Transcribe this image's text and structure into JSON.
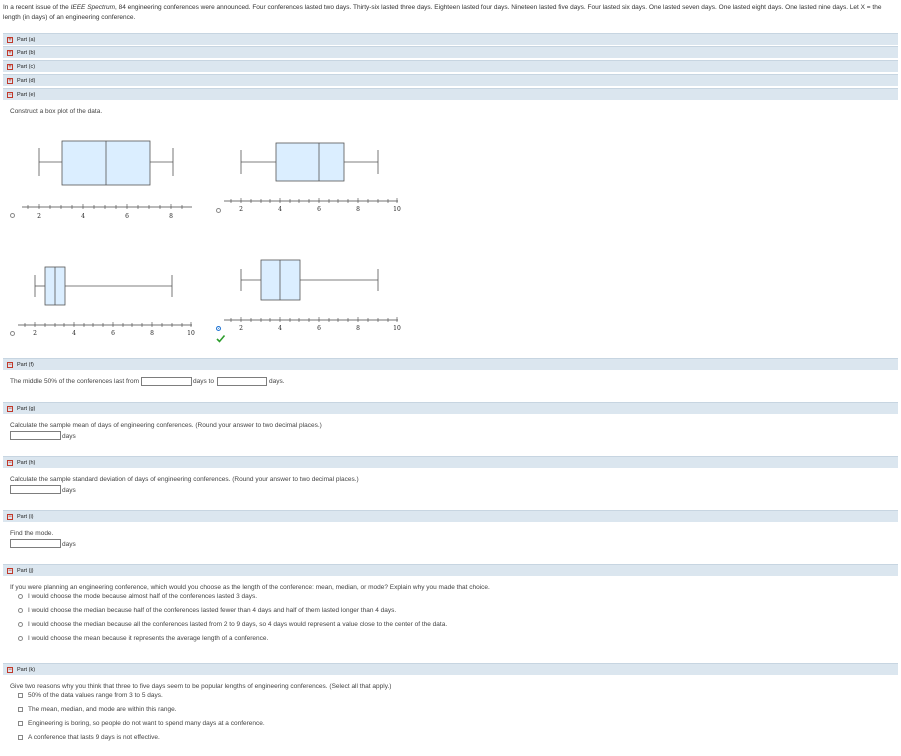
{
  "intro": {
    "text_before": "In a recent issue of the ",
    "journal": "IEEE Spectrum",
    "text_after": ", 84 engineering conferences were announced. Four conferences lasted two days. Thirty-six lasted three days. Eighteen lasted four days. Nineteen lasted five days. Four lasted six days. One lasted seven days. One lasted eight days. One lasted nine days. Let X = the length (in days) of an engineering conference."
  },
  "parts": {
    "a": "Part (a)",
    "b": "Part (b)",
    "c": "Part (c)",
    "d": "Part (d)",
    "e": "Part (e)",
    "f": "Part (f)",
    "g": "Part (g)",
    "h": "Part (h)",
    "i": "Part (i)",
    "j": "Part (j)",
    "k": "Part (k)"
  },
  "part_e": {
    "prompt": "Construct a box plot of the data.",
    "plots": [
      {
        "ticks": [
          "2",
          "4",
          "6",
          "8"
        ],
        "selected": false
      },
      {
        "ticks": [
          "2",
          "4",
          "6",
          "8",
          "10"
        ],
        "selected": false
      },
      {
        "ticks": [
          "2",
          "4",
          "6",
          "8",
          "10"
        ],
        "selected": false
      },
      {
        "ticks": [
          "2",
          "4",
          "6",
          "8",
          "10"
        ],
        "selected": true
      }
    ]
  },
  "part_f": {
    "prefix": "The middle 50% of the conferences last from",
    "middle": "days to",
    "suffix": "days."
  },
  "part_g": {
    "prompt": "Calculate the sample mean of days of engineering conferences. (Round your answer to two decimal places.)",
    "unit": "days"
  },
  "part_h": {
    "prompt": "Calculate the sample standard deviation of days of engineering conferences. (Round your answer to two decimal places.)",
    "unit": "days"
  },
  "part_i": {
    "prompt": "Find the mode.",
    "unit": "days"
  },
  "part_j": {
    "prompt": "If you were planning an engineering conference, which would you choose as the length of the conference: mean, median, or mode? Explain why you made that choice.",
    "options": [
      "I would choose the mode because almost half of the conferences lasted 3 days.",
      "I would choose the median because half of the conferences lasted fewer than 4 days and half of them lasted longer than 4 days.",
      "I would choose the median because all the conferences lasted from 2 to 9 days, so 4 days would represent a value close to the center of the data.",
      "I would choose the mean because it represents the average length of a conference."
    ]
  },
  "part_k": {
    "prompt": "Give two reasons why you think that three to five days seem to be popular lengths of engineering conferences. (Select all that apply.)",
    "options": [
      "50% of the data values range from 3 to 5 days.",
      "The mean, median, and mode are within this range.",
      "Engineering is boring, so people do not want to spend many days at a conference.",
      "A conference that lasts 9 days is not effective."
    ]
  },
  "colors": {
    "bar": "#dbe6ef",
    "box_fill": "#dbeeff",
    "box_stroke": "#555555",
    "check": "#2e9d2e",
    "radio_selected": "#1f74d4"
  }
}
